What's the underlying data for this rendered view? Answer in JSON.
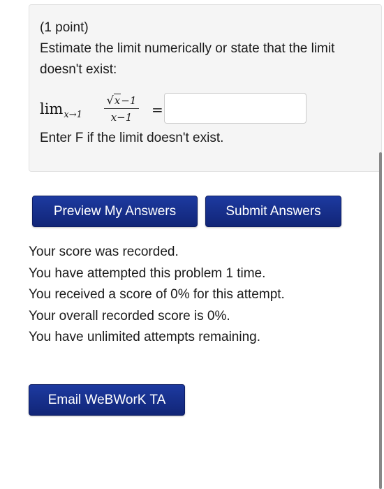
{
  "problem": {
    "points": "(1 point)",
    "instruction": "Estimate the limit numerically or state that the limit doesn't exist:",
    "math": {
      "lim": "lim",
      "subscript": "x→1",
      "numerator_radicand": "x",
      "numerator_rest": "−1",
      "denominator": "x−1",
      "equals": "="
    },
    "answer_value": "",
    "hint": "Enter F if the limit doesn't exist."
  },
  "buttons": {
    "preview": "Preview My Answers",
    "submit": "Submit Answers",
    "email": "Email WeBWorK TA"
  },
  "results": {
    "line1": "Your score was recorded.",
    "line2": "You have attempted this problem 1 time.",
    "line3": "You received a score of 0% for this attempt.",
    "line4": "Your overall recorded score is 0%.",
    "line5": "You have unlimited attempts remaining."
  },
  "colors": {
    "button_bg": "#1a2f8a",
    "panel_bg": "#f5f5f5"
  }
}
